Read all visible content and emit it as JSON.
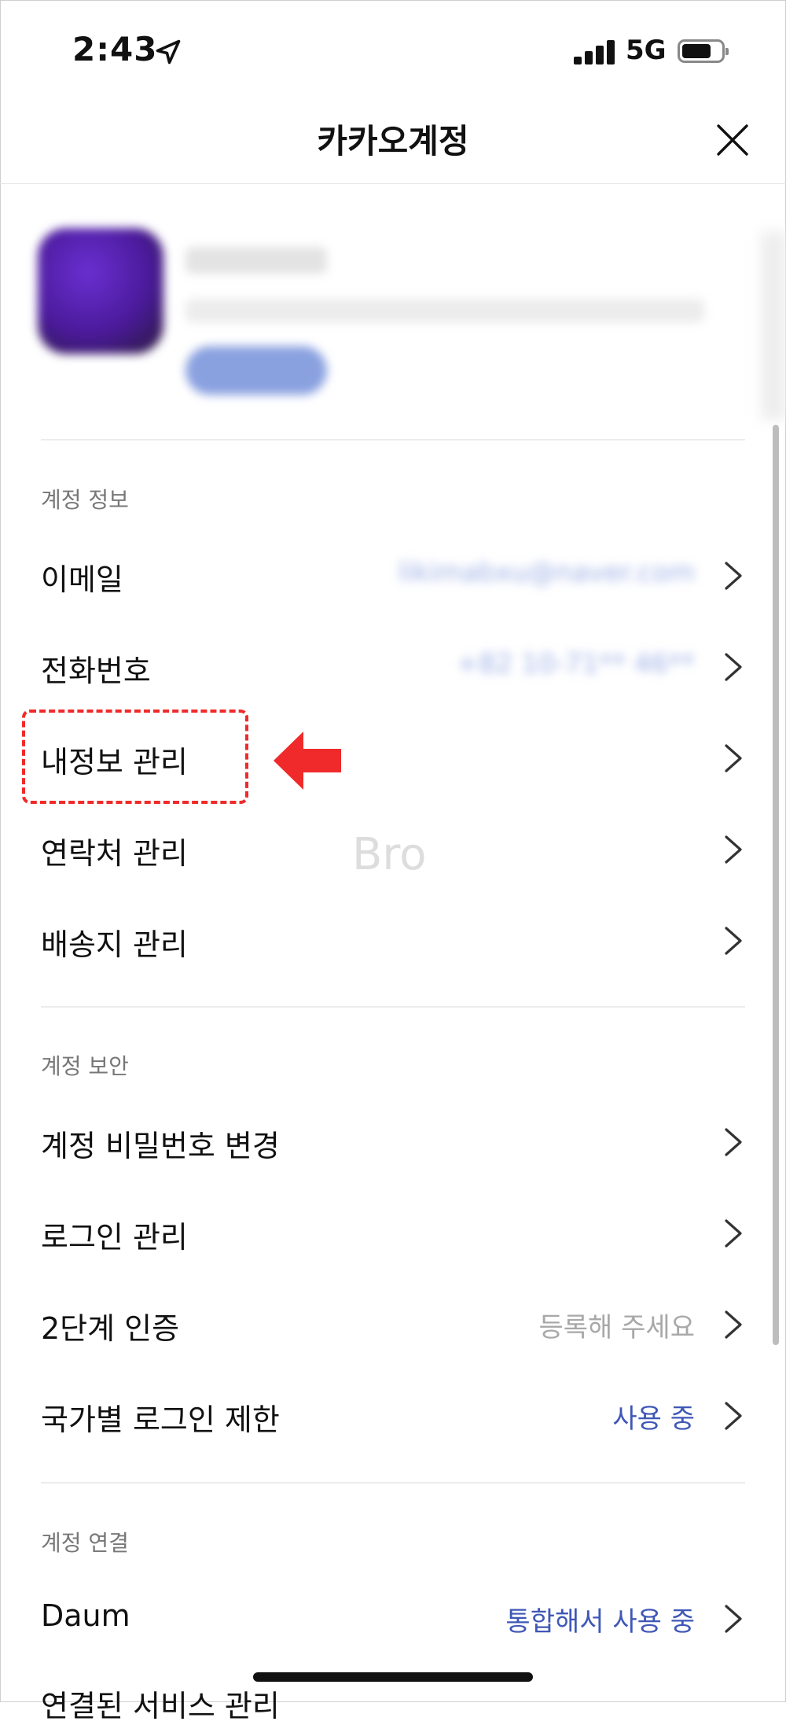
{
  "status_bar": {
    "time": "2:43",
    "network": "5G"
  },
  "header": {
    "title": "카카오계정"
  },
  "sections": [
    {
      "title": "계정 정보",
      "rows": [
        {
          "label": "이메일",
          "value": "likimabxu@naver.com"
        },
        {
          "label": "전화번호",
          "value": "+82 10-71** 46**"
        },
        {
          "label": "내정보 관리"
        },
        {
          "label": "연락처 관리"
        },
        {
          "label": "배송지 관리"
        }
      ]
    },
    {
      "title": "계정 보안",
      "rows": [
        {
          "label": "계정 비밀번호 변경"
        },
        {
          "label": "로그인 관리"
        },
        {
          "label": "2단계 인증",
          "value": "등록해 주세요"
        },
        {
          "label": "국가별 로그인 제한",
          "value": "사용 중"
        }
      ]
    },
    {
      "title": "계정 연결",
      "rows": [
        {
          "label": "Daum",
          "value": "통합해서 사용 중"
        },
        {
          "label": "연결된 서비스 관리"
        }
      ]
    }
  ],
  "watermark": "Bro",
  "colors": {
    "accent_blue": "#3f57b6",
    "highlight_red": "#f02a2a",
    "muted_text": "#a8a8a8"
  }
}
